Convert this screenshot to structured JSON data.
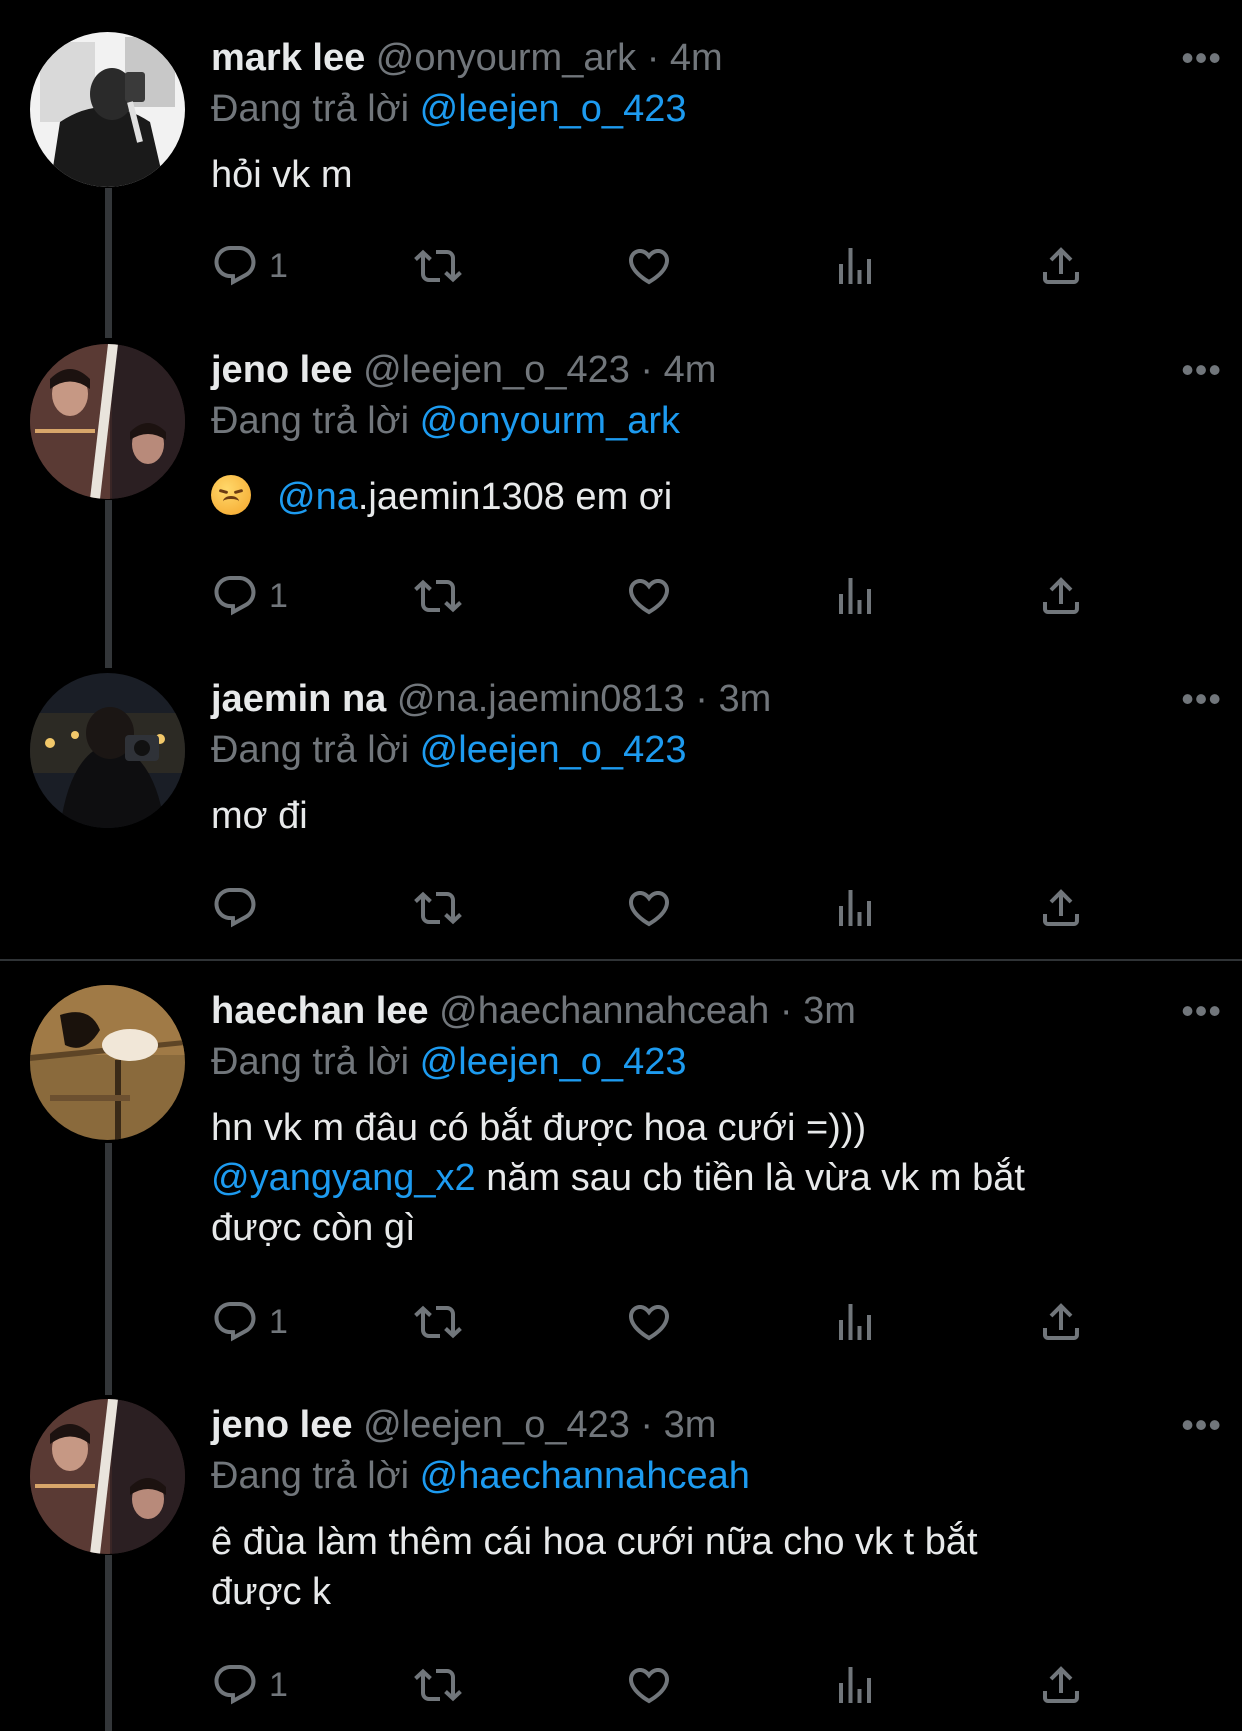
{
  "reply_prefix": "Đang trả lời",
  "more_label": "•••",
  "colors": {
    "background": "#000000",
    "text": "#e7e9ea",
    "muted": "#71767b",
    "accent": "#1d9bf0"
  },
  "action_icons": [
    "reply-icon",
    "retweet-icon",
    "like-icon",
    "views-icon",
    "share-icon"
  ],
  "tweets": [
    {
      "name": "mark lee",
      "handle_time": "@onyourm_ark · 4m",
      "replying_to": "@leejen_o_423",
      "text": "hỏi vk m",
      "reply_count": "1"
    },
    {
      "name": "jeno lee",
      "handle_time": "@leejen_o_423 · 4m",
      "replying_to": "@onyourm_ark",
      "emoji": "disappointed-face-emoji",
      "mention": "@na",
      "text": ".jaemin1308 em ơi",
      "reply_count": "1"
    },
    {
      "name": "jaemin na",
      "handle_time": "@na.jaemin0813 · 3m",
      "replying_to": "@leejen_o_423",
      "text": "mơ đi",
      "reply_count": ""
    },
    {
      "name": "haechan lee",
      "handle_time": "@haechannahceah · 3m",
      "replying_to": "@leejen_o_423",
      "text_line1": "hn vk m đâu có bắt được hoa cưới =)))",
      "mention": "@yangyang_x2",
      "text_line2": " năm sau cb tiền là vừa vk m bắt",
      "text_line3": "được còn gì",
      "reply_count": "1"
    },
    {
      "name": "jeno lee",
      "handle_time": "@leejen_o_423 · 3m",
      "replying_to": "@haechannahceah",
      "text_line1": "ê đùa làm thêm cái hoa cưới nữa cho vk t bắt",
      "text_line2": "được k",
      "reply_count": "1"
    }
  ]
}
